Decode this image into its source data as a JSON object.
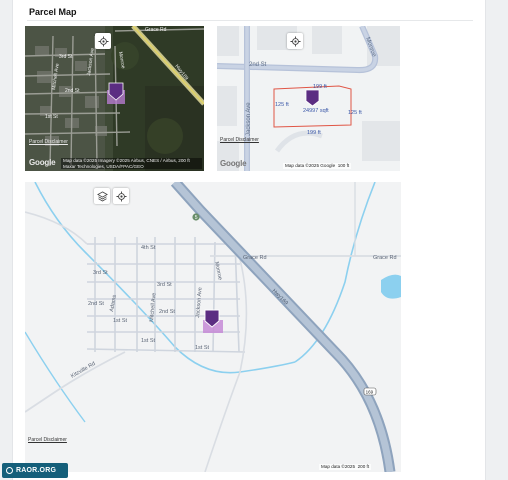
{
  "section": {
    "title": "Parcel Map"
  },
  "satellite_map": {
    "roads": [
      "Grace Rd",
      "3rd St",
      "2nd St",
      "1st St",
      "Mitchell Ave",
      "Jackson Ave",
      "Monroe",
      "Hwy169"
    ],
    "disclaimer": "Parcel Disclaimer",
    "attribution_line1": "Map data ©2025 Imagery ©2025 Airbus, CNES / Airbus,",
    "attribution_line2": "Maxar Technologies, USDA/FPAC/GEO",
    "scale": "200 ft",
    "logo": "Google",
    "controls": [
      "locate-icon"
    ]
  },
  "detail_map": {
    "roads": [
      "2nd St",
      "Jackson Ave",
      "Monroe"
    ],
    "dimensions": {
      "top": "199 ft",
      "bottom": "199 ft",
      "left": "125 ft",
      "right": "125 ft"
    },
    "area": "24997 sqft",
    "disclaimer": "Parcel Disclaimer",
    "attribution": "Map data ©2025 Google",
    "scale": "100 ft",
    "logo": "Google",
    "controls": [
      "locate-icon"
    ]
  },
  "overview_map": {
    "roads": [
      "4th St",
      "3rd St",
      "3rd St",
      "2nd St",
      "2nd St",
      "1st St",
      "1st St",
      "1st St",
      "Adams",
      "Mitchell Ave",
      "Jackson Ave",
      "Monroe",
      "Grace Rd",
      "Grace Rd",
      "Hwy169",
      "Kitzville Rd"
    ],
    "shields": [
      "5",
      "169"
    ],
    "disclaimer": "Parcel Disclaimer",
    "attribution": "Map data ©2025",
    "scale": "200 ft",
    "controls": [
      "layers-icon",
      "locate-icon"
    ]
  },
  "badge": {
    "text": "RAOR.ORG"
  },
  "colors": {
    "marker": "#5b2d82",
    "parcel_fill": "#c58ad6",
    "highway": "#9eb0c8",
    "water": "#8cd0ef",
    "parcel_outline": "#e05545"
  }
}
